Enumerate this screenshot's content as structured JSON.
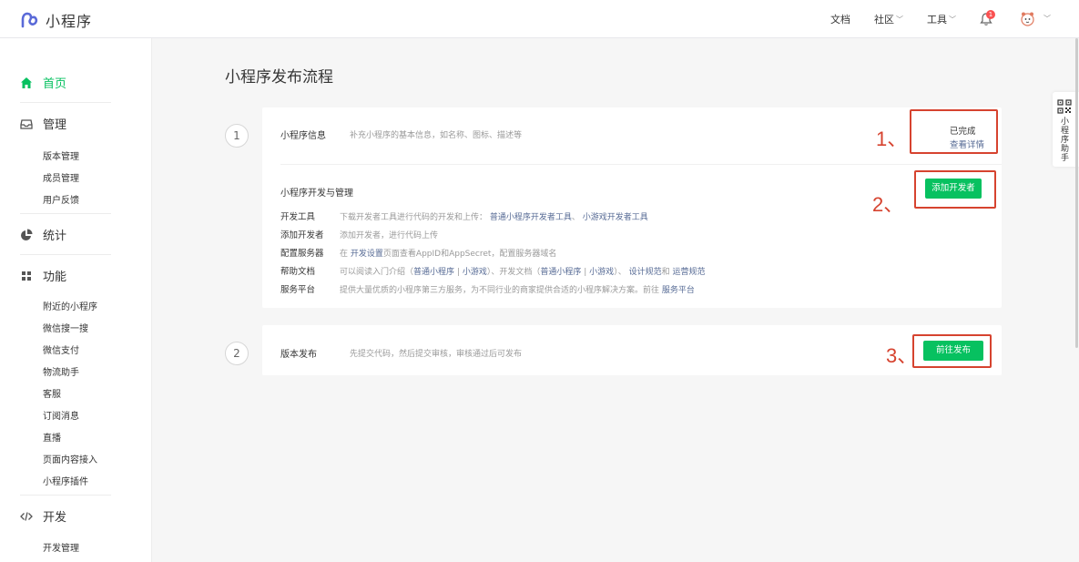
{
  "header": {
    "logo_text": "小程序",
    "nav": [
      {
        "label": "文档",
        "has_menu": false
      },
      {
        "label": "社区",
        "has_menu": true
      },
      {
        "label": "工具",
        "has_menu": true
      }
    ],
    "notification_count": "1"
  },
  "sidebar": {
    "home": "首页",
    "manage": {
      "title": "管理",
      "items": [
        "版本管理",
        "成员管理",
        "用户反馈"
      ]
    },
    "stats": "统计",
    "features": {
      "title": "功能",
      "items": [
        "附近的小程序",
        "微信搜一搜",
        "微信支付",
        "物流助手",
        "客服",
        "订阅消息",
        "直播",
        "页面内容接入",
        "小程序插件"
      ]
    },
    "dev": {
      "title": "开发",
      "items": [
        "开发管理"
      ]
    }
  },
  "main": {
    "title": "小程序发布流程",
    "step1": {
      "number": "1",
      "info_title": "小程序信息",
      "info_desc": "补充小程序的基本信息，如名称、图标、描述等",
      "status": "已完成",
      "detail_link": "查看详情",
      "dev_title": "小程序开发与管理",
      "add_dev_button": "添加开发者",
      "rows": [
        {
          "label": "开发工具",
          "pre": "下载开发者工具进行代码的开发和上传：",
          "link1": "普通小程序开发者工具",
          "mid": "、",
          "link2": "小游戏开发者工具"
        },
        {
          "label": "添加开发者",
          "text": "添加开发者，进行代码上传"
        },
        {
          "label": "配置服务器",
          "pre": "在",
          "link1": "开发设置",
          "post": "页面查看AppID和AppSecret，配置服务器域名"
        },
        {
          "label": "帮助文档",
          "p1": "可以阅读入门介绍（",
          "l1": "普通小程序",
          "s1": "|",
          "l2": "小游戏",
          "p2": "）、开发文档（",
          "l3": "普通小程序",
          "s2": "|",
          "l4": "小游戏",
          "p3": "）、",
          "l5": "设计规范",
          "p4": "和",
          "l6": "运营规范"
        },
        {
          "label": "服务平台",
          "pre": "提供大量优质的小程序第三方服务，为不同行业的商家提供合适的小程序解决方案。前往",
          "link1": "服务平台"
        }
      ]
    },
    "step2": {
      "number": "2",
      "title": "版本发布",
      "desc": "先提交代码，然后提交审核，审核通过后可发布",
      "publish_button": "前往发布"
    },
    "annotations": [
      "1、",
      "2、",
      "3、"
    ]
  },
  "helper": {
    "label": "小程序助手"
  },
  "colors": {
    "accent": "#07c160",
    "link": "#576b95",
    "annotation": "#d6432f"
  }
}
